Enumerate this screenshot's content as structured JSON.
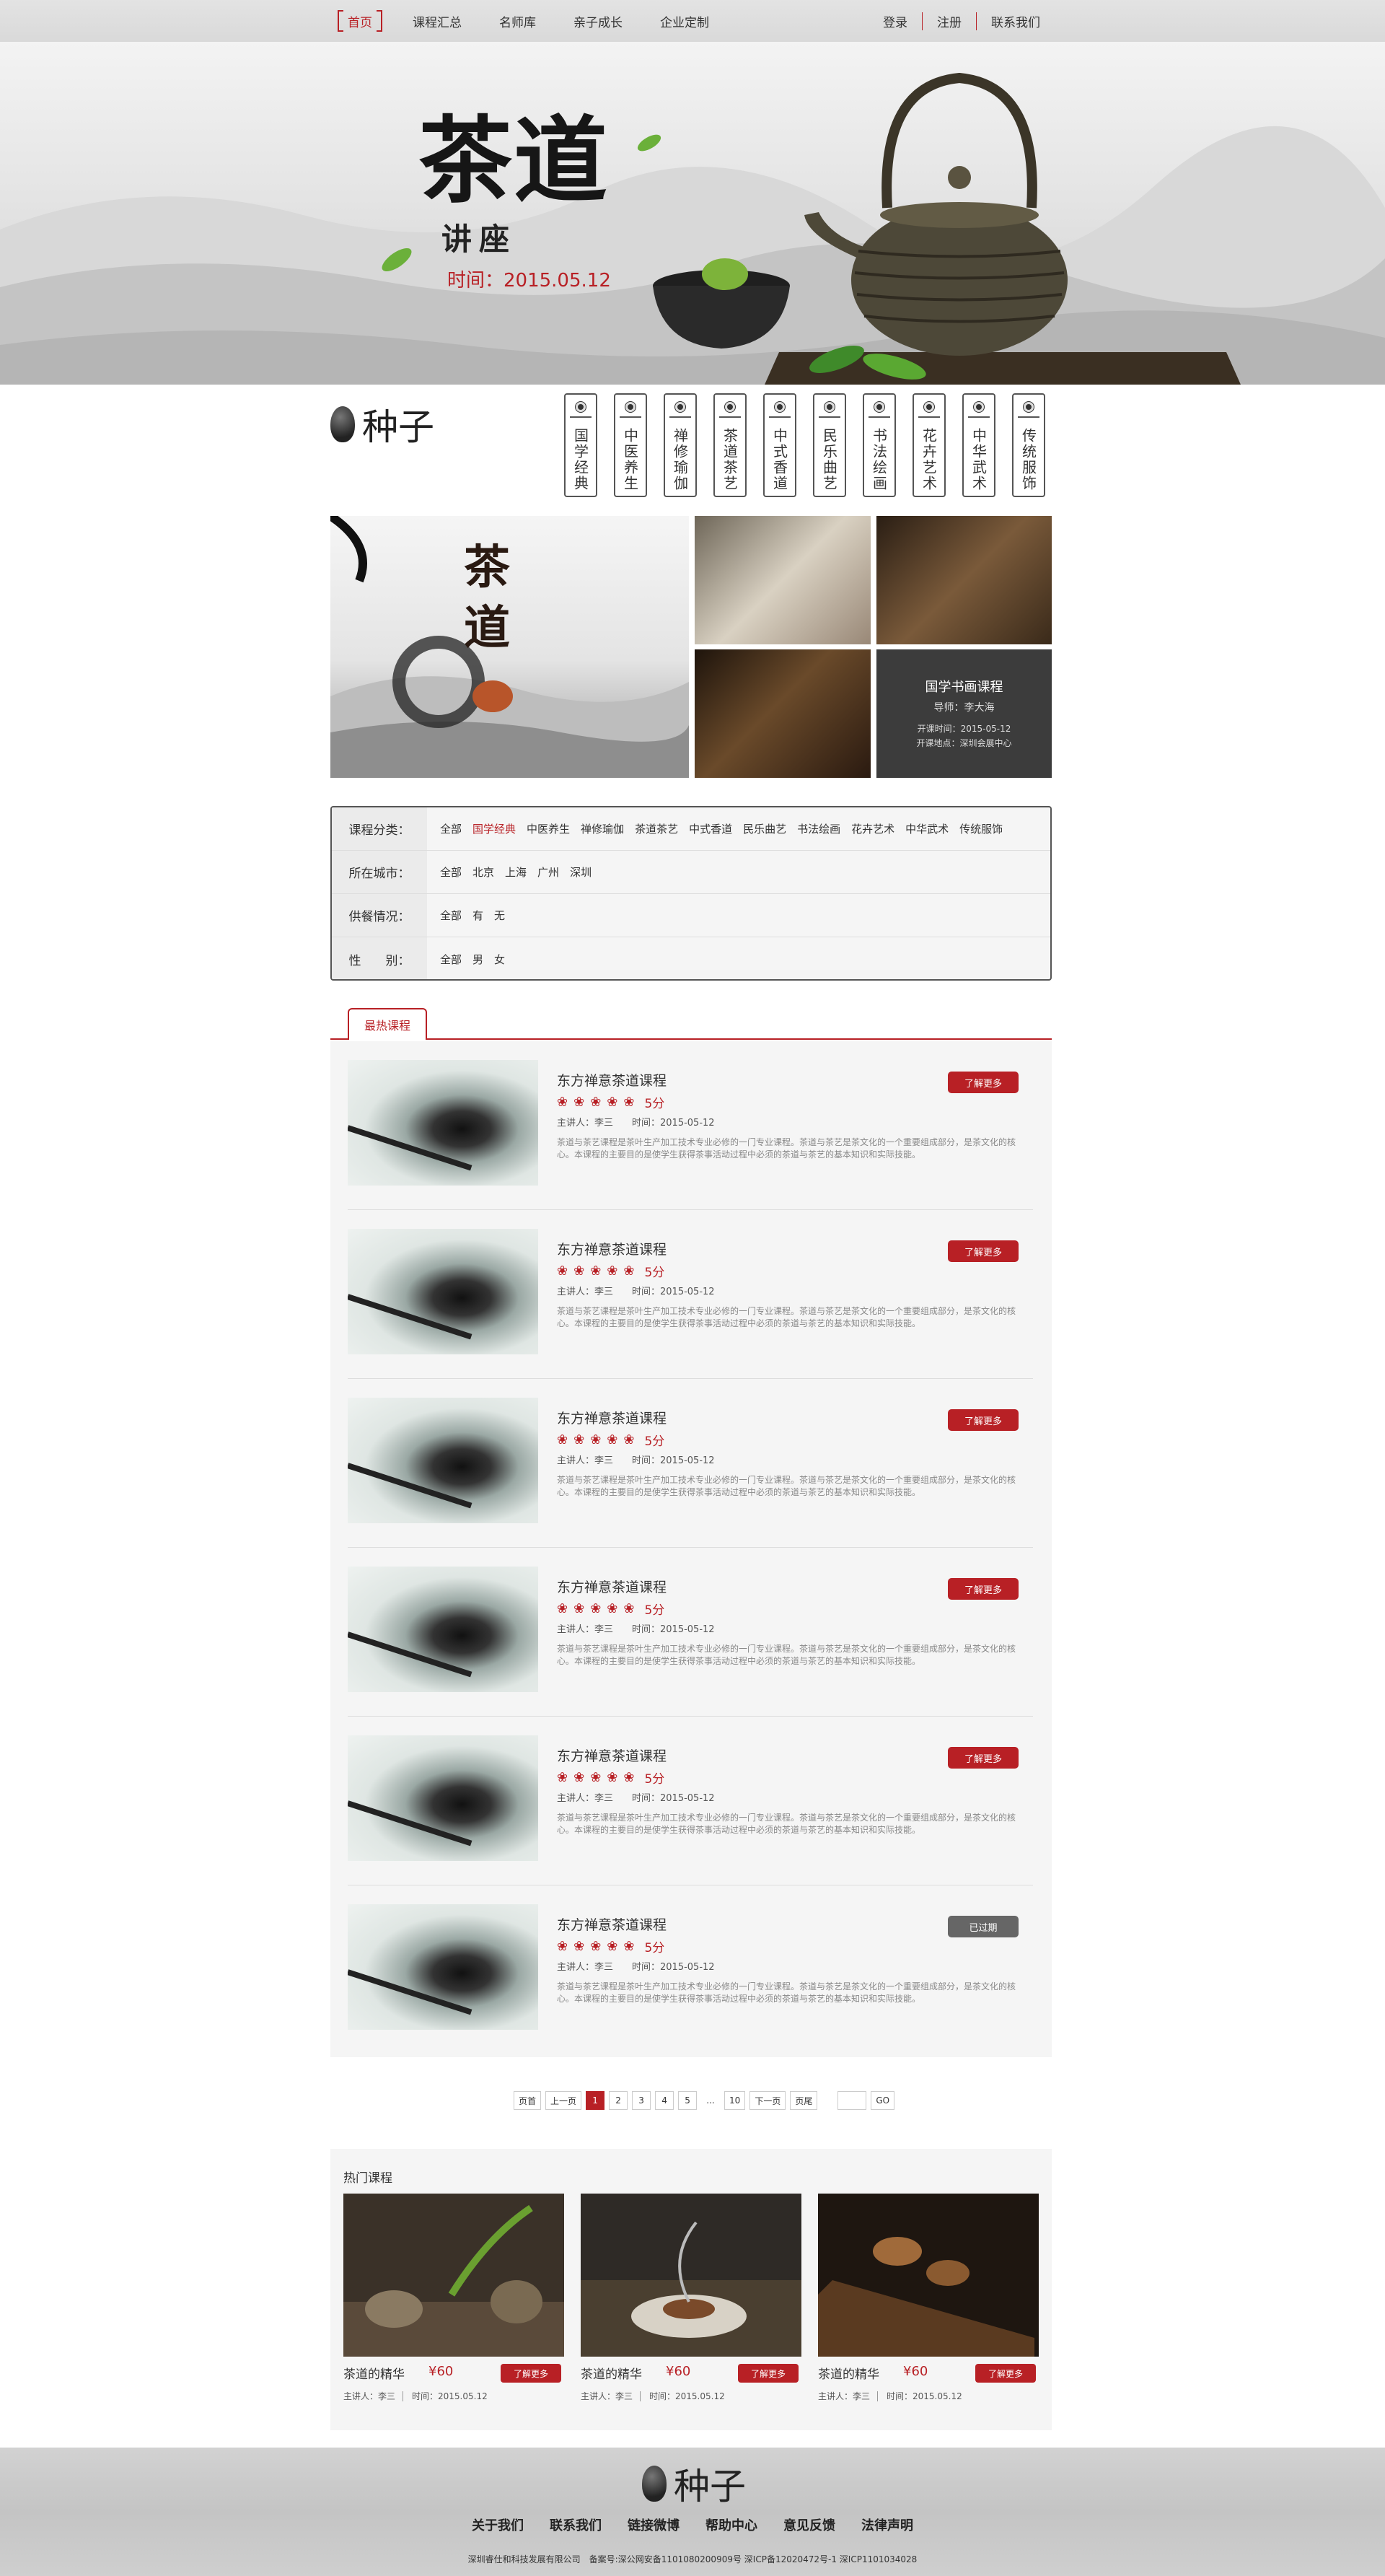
{
  "topnav": {
    "items": [
      "首页",
      "课程汇总",
      "名师库",
      "亲子成长",
      "企业定制"
    ],
    "right": [
      "登录",
      "注册",
      "联系我们"
    ]
  },
  "banner": {
    "title": "茶道",
    "subtitle": "讲座",
    "date": "时间：2015.05.12"
  },
  "logo": {
    "text": "种子"
  },
  "categories": [
    "国学经典",
    "中医养生",
    "禅修瑜伽",
    "茶道茶艺",
    "中式香道",
    "民乐曲艺",
    "书法绘画",
    "花卉艺术",
    "中华武术",
    "传统服饰"
  ],
  "gallery": {
    "big_title": "茶道",
    "promo": {
      "title": "国学书画课程",
      "mentor": "导师：李大海",
      "time": "开课时间：2015-05-12",
      "place": "开课地点：深圳会展中心"
    }
  },
  "filters": [
    {
      "label": "课程分类：",
      "options": [
        "全部",
        "国学经典",
        "中医养生",
        "禅修瑜伽",
        "茶道茶艺",
        "中式香道",
        "民乐曲艺",
        "书法绘画",
        "花卉艺术",
        "中华武术",
        "传统服饰"
      ],
      "active": 1
    },
    {
      "label": "所在城市：",
      "options": [
        "全部",
        "北京",
        "上海",
        "广州",
        "深圳"
      ],
      "active": -1
    },
    {
      "label": "供餐情况：",
      "options": [
        "全部",
        "有",
        "无"
      ],
      "active": -1
    },
    {
      "label": "性　　别：",
      "options": [
        "全部",
        "男",
        "女"
      ],
      "active": -1
    }
  ],
  "hot_tab": "最热课程",
  "courses": [
    {
      "title": "东方禅意茶道课程",
      "score": "5分",
      "speaker": "主讲人：李三",
      "time": "时间：2015-05-12",
      "desc": "茶道与茶艺课程是茶叶生产加工技术专业必修的一门专业课程。茶道与茶艺是茶文化的一个重要组成部分，是茶文化的核心。本课程的主要目的是使学生获得茶事活动过程中必须的茶道与茶艺的基本知识和实际技能。",
      "button": "了解更多",
      "expired": false
    },
    {
      "title": "东方禅意茶道课程",
      "score": "5分",
      "speaker": "主讲人：李三",
      "time": "时间：2015-05-12",
      "desc": "茶道与茶艺课程是茶叶生产加工技术专业必修的一门专业课程。茶道与茶艺是茶文化的一个重要组成部分，是茶文化的核心。本课程的主要目的是使学生获得茶事活动过程中必须的茶道与茶艺的基本知识和实际技能。",
      "button": "了解更多",
      "expired": false
    },
    {
      "title": "东方禅意茶道课程",
      "score": "5分",
      "speaker": "主讲人：李三",
      "time": "时间：2015-05-12",
      "desc": "茶道与茶艺课程是茶叶生产加工技术专业必修的一门专业课程。茶道与茶艺是茶文化的一个重要组成部分，是茶文化的核心。本课程的主要目的是使学生获得茶事活动过程中必须的茶道与茶艺的基本知识和实际技能。",
      "button": "了解更多",
      "expired": false
    },
    {
      "title": "东方禅意茶道课程",
      "score": "5分",
      "speaker": "主讲人：李三",
      "time": "时间：2015-05-12",
      "desc": "茶道与茶艺课程是茶叶生产加工技术专业必修的一门专业课程。茶道与茶艺是茶文化的一个重要组成部分，是茶文化的核心。本课程的主要目的是使学生获得茶事活动过程中必须的茶道与茶艺的基本知识和实际技能。",
      "button": "了解更多",
      "expired": false
    },
    {
      "title": "东方禅意茶道课程",
      "score": "5分",
      "speaker": "主讲人：李三",
      "time": "时间：2015-05-12",
      "desc": "茶道与茶艺课程是茶叶生产加工技术专业必修的一门专业课程。茶道与茶艺是茶文化的一个重要组成部分，是茶文化的核心。本课程的主要目的是使学生获得茶事活动过程中必须的茶道与茶艺的基本知识和实际技能。",
      "button": "了解更多",
      "expired": false
    },
    {
      "title": "东方禅意茶道课程",
      "score": "5分",
      "speaker": "主讲人：李三",
      "time": "时间：2015-05-12",
      "desc": "茶道与茶艺课程是茶叶生产加工技术专业必修的一门专业课程。茶道与茶艺是茶文化的一个重要组成部分，是茶文化的核心。本课程的主要目的是使学生获得茶事活动过程中必须的茶道与茶艺的基本知识和实际技能。",
      "button": "已过期",
      "expired": true
    }
  ],
  "pagination": {
    "first": "页首",
    "prev": "上一页",
    "pages": [
      "1",
      "2",
      "3",
      "4",
      "5"
    ],
    "ellipsis": "...",
    "last_page": "10",
    "next": "下一页",
    "end": "页尾",
    "go": "GO",
    "current": "1"
  },
  "hot_courses": {
    "title": "热门课程",
    "items": [
      {
        "name": "茶道的精华",
        "price": "¥60",
        "button": "了解更多",
        "speaker": "主讲人：李三",
        "time": "时间：2015.05.12"
      },
      {
        "name": "茶道的精华",
        "price": "¥60",
        "button": "了解更多",
        "speaker": "主讲人：李三",
        "time": "时间：2015.05.12"
      },
      {
        "name": "茶道的精华",
        "price": "¥60",
        "button": "了解更多",
        "speaker": "主讲人：李三",
        "time": "时间：2015.05.12"
      }
    ]
  },
  "footer": {
    "links": [
      "关于我们",
      "联系我们",
      "链接微博",
      "帮助中心",
      "意见反馈",
      "法律声明"
    ],
    "legal": "深圳睿仕和科技发展有限公司　备案号:深公网安备1101080200909号 深ICP备12020472号-1 深ICP1101034028"
  },
  "colors": {
    "accent": "#b82025",
    "expired": "#666666"
  }
}
